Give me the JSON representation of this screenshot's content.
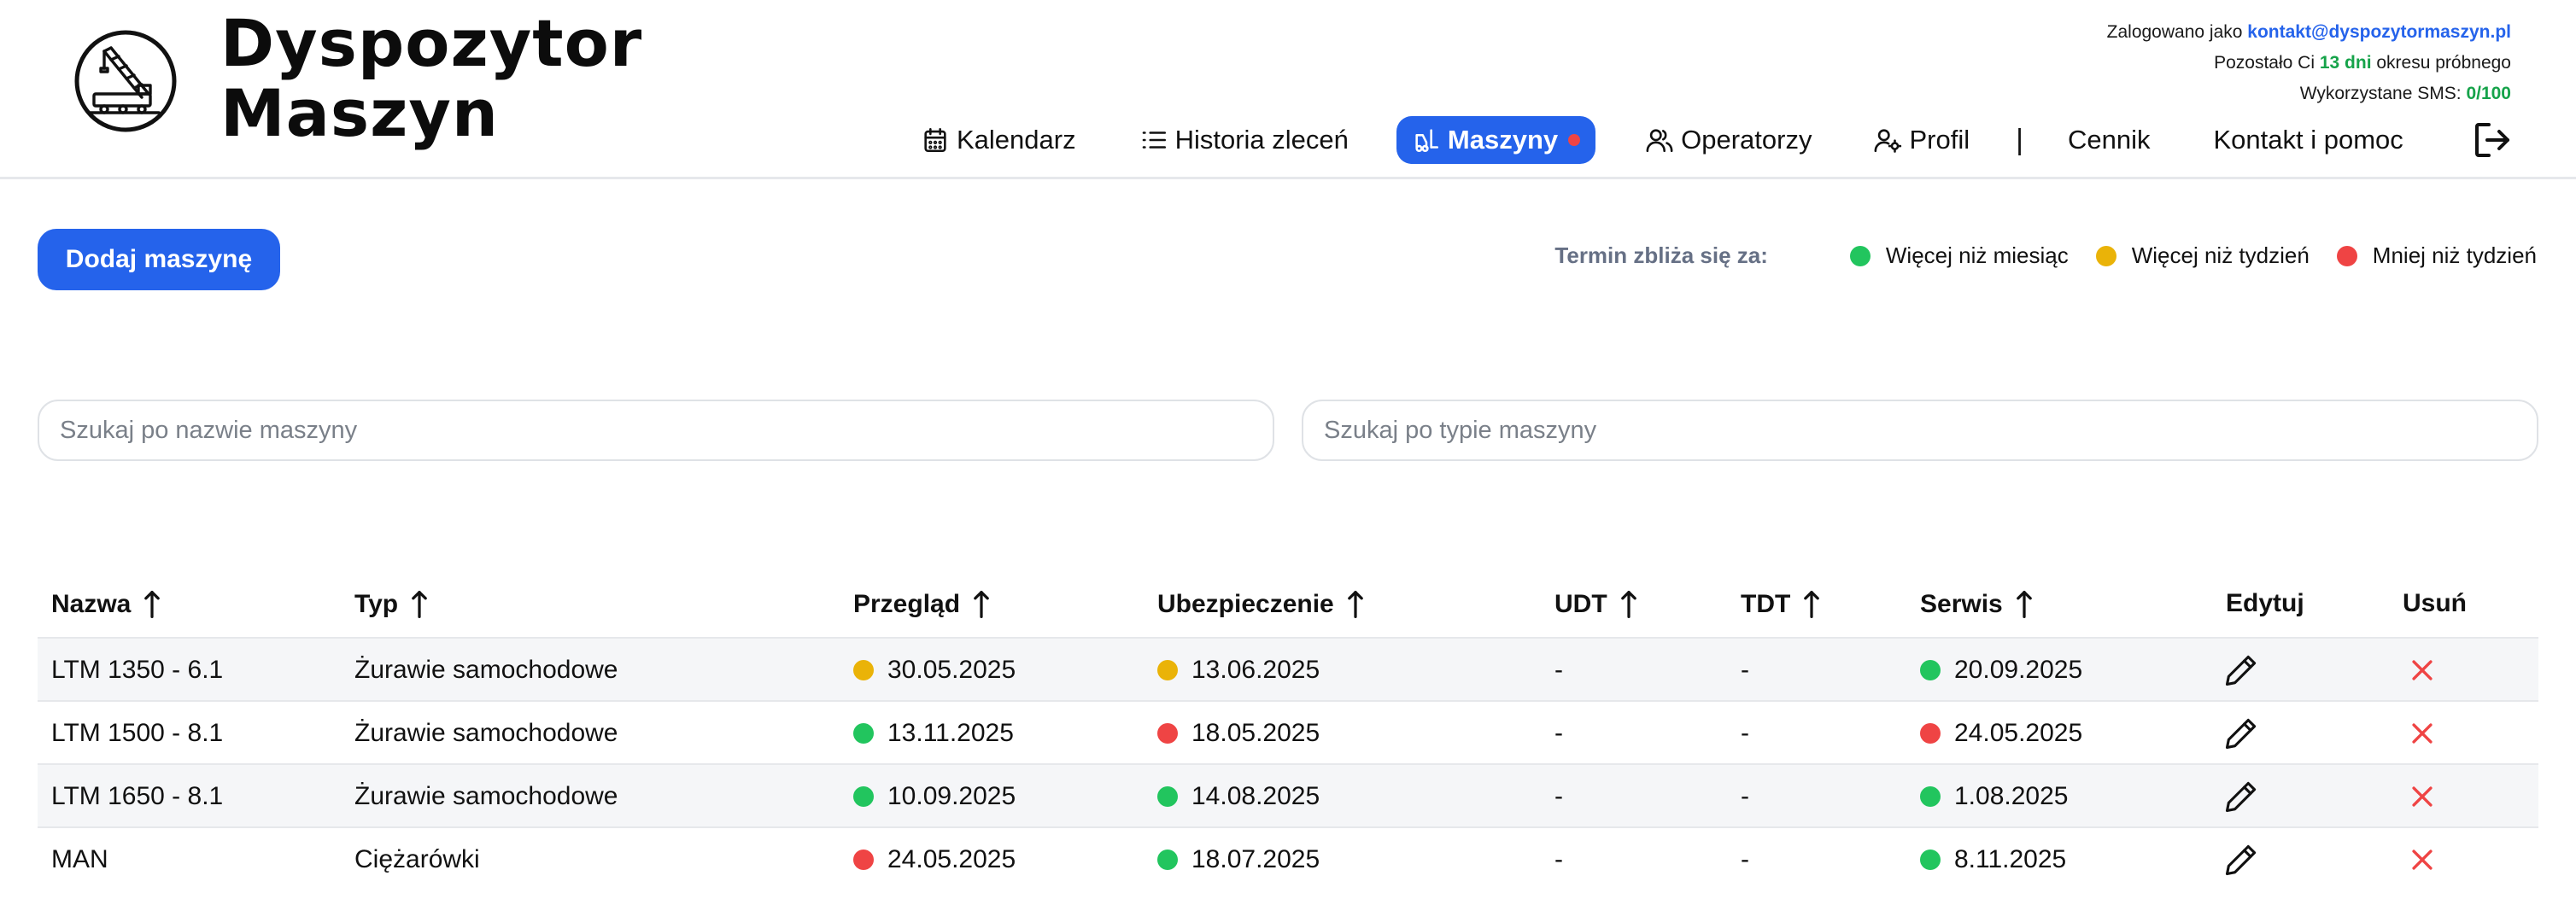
{
  "app": {
    "brand_line1": "Dyspozytor",
    "brand_line2": "Maszyn"
  },
  "account": {
    "logged_prefix": "Zalogowano jako",
    "email": "kontakt@dyspozytormaszyn.pl",
    "trial_prefix": "Pozostało Ci",
    "trial_days": "13 dni",
    "trial_suffix": "okresu próbnego",
    "sms_prefix": "Wykorzystane SMS:",
    "sms_value": "0/100"
  },
  "nav": {
    "items": [
      {
        "label": "Kalendarz",
        "icon": "calendar-icon"
      },
      {
        "label": "Historia zleceń",
        "icon": "list-icon"
      },
      {
        "label": "Maszyny",
        "icon": "forklift-icon",
        "active": true
      },
      {
        "label": "Operatorzy",
        "icon": "users-icon"
      },
      {
        "label": "Profil",
        "icon": "user-gear-icon"
      }
    ],
    "separator": "|",
    "pricing": "Cennik",
    "contact": "Kontakt i pomoc",
    "logout_icon": "logout-icon"
  },
  "toolbar": {
    "add_label": "Dodaj maszynę"
  },
  "legend": {
    "title": "Termin zbliża się za:",
    "items": [
      {
        "label": "Więcej niż miesiąc",
        "color": "#22c55e"
      },
      {
        "label": "Więcej niż tydzień",
        "color": "#eab308"
      },
      {
        "label": "Mniej niż tydzień",
        "color": "#ef4444"
      }
    ]
  },
  "search": {
    "name_placeholder": "Szukaj po nazwie maszyny",
    "type_placeholder": "Szukaj po typie maszyny"
  },
  "colors": {
    "accent": "#2563eb",
    "green": "#22c55e",
    "yellow": "#eab308",
    "red": "#ef4444"
  },
  "table": {
    "headers": {
      "name": "Nazwa",
      "type": "Typ",
      "inspection": "Przegląd",
      "insurance": "Ubezpieczenie",
      "udt": "UDT",
      "tdt": "TDT",
      "service": "Serwis",
      "edit": "Edytuj",
      "delete": "Usuń"
    },
    "rows": [
      {
        "name": "LTM 1350 - 6.1",
        "type": "Żurawie samochodowe",
        "inspection": {
          "date": "30.05.2025",
          "status": "yellow"
        },
        "insurance": {
          "date": "13.06.2025",
          "status": "yellow"
        },
        "udt": "-",
        "tdt": "-",
        "service": {
          "date": "20.09.2025",
          "status": "green"
        }
      },
      {
        "name": "LTM 1500 - 8.1",
        "type": "Żurawie samochodowe",
        "inspection": {
          "date": "13.11.2025",
          "status": "green"
        },
        "insurance": {
          "date": "18.05.2025",
          "status": "red"
        },
        "udt": "-",
        "tdt": "-",
        "service": {
          "date": "24.05.2025",
          "status": "red"
        }
      },
      {
        "name": "LTM 1650 - 8.1",
        "type": "Żurawie samochodowe",
        "inspection": {
          "date": "10.09.2025",
          "status": "green"
        },
        "insurance": {
          "date": "14.08.2025",
          "status": "green"
        },
        "udt": "-",
        "tdt": "-",
        "service": {
          "date": "1.08.2025",
          "status": "green"
        }
      },
      {
        "name": "MAN",
        "type": "Ciężarówki",
        "inspection": {
          "date": "24.05.2025",
          "status": "red"
        },
        "insurance": {
          "date": "18.07.2025",
          "status": "green"
        },
        "udt": "-",
        "tdt": "-",
        "service": {
          "date": "8.11.2025",
          "status": "green"
        }
      }
    ]
  }
}
